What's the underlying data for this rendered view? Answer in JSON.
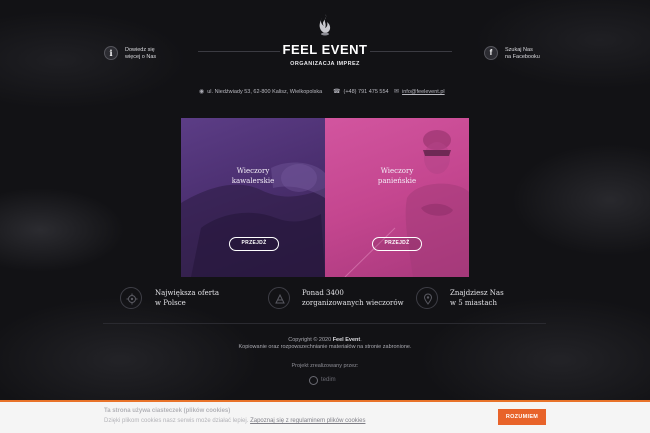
{
  "header": {
    "brand": "FEEL EVENT",
    "subtitle": "ORGANIZACJA IMPREZ",
    "info_line1": "Dowiedz się",
    "info_line2": "więcej o Nas",
    "fb_line1": "Szukaj Nas",
    "fb_line2": "na Facebooku",
    "info_icon_glyph": "i",
    "fb_icon_glyph": "f"
  },
  "contact": {
    "address": "ul. Niedźwiady 53, 62-800 Kalisz, Wielkopolska",
    "phone": "(+48) 791 475 554",
    "email": "info@feelevent.pl"
  },
  "panels": {
    "left": {
      "line1": "Wieczory",
      "line2": "kawalerskie",
      "button": "PRZEJDŹ"
    },
    "right": {
      "line1": "Wieczory",
      "line2": "panieńskie",
      "button": "PRZEJDŹ"
    }
  },
  "features": [
    {
      "line1": "Największa oferta",
      "line2": "w Polsce",
      "icon": "gear-icon"
    },
    {
      "line1": "Ponad 3400",
      "line2": "zorganizowanych wieczorów",
      "icon": "party-icon"
    },
    {
      "line1": "Znajdziesz Nas",
      "line2": "w 5 miastach",
      "icon": "map-pin-icon"
    }
  ],
  "footer": {
    "copyright_prefix": "Copyright © 2020",
    "copyright_brand": "Feel Event",
    "copyright_suffix": ".",
    "notice": "Kopiowanie oraz rozpowszechnianie materiałów na stronie zabronione.",
    "realized_by": "Projekt zrealizowany przez:",
    "agency": "tedim"
  },
  "cookie": {
    "title": "Ta strona używa ciasteczek (plików cookies)",
    "text": "Dzięki plikom cookies nasz serwis może działać lepiej.",
    "link": "Zapoznaj się z regulaminem plików cookies",
    "button": "ROZUMIEM"
  },
  "colors": {
    "background": "#121215",
    "panel_left": "#4b2f70",
    "panel_right": "#c4468f",
    "cookie_accent": "#e8632a"
  }
}
